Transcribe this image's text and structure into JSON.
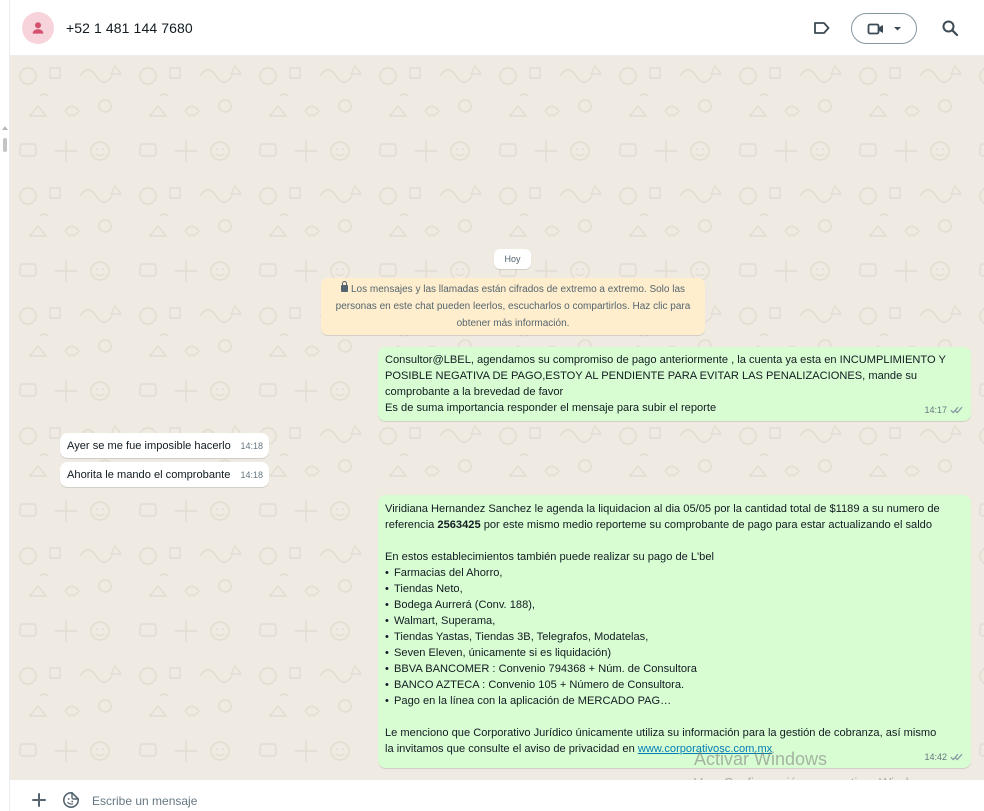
{
  "header": {
    "contact_name": "+52 1 481 144 7680",
    "icons": [
      "person-icon",
      "label-icon",
      "video-camera-icon",
      "chevron-down-icon",
      "search-icon"
    ],
    "accent_avatar_bg": "#f7d4dc"
  },
  "chat": {
    "wallpaper_color": "#efeae2",
    "day_label": "Hoy",
    "encryption_notice": {
      "line1": "Los mensajes y las llamadas están cifrados de extremo a extremo. Solo las",
      "line2": "personas en este chat pueden leerlos, escucharlos o compartirlos. Haz clic para",
      "line3": "obtener más información."
    },
    "messages": [
      {
        "direction": "outgoing",
        "lines": [
          "Consultor@LBEL, agendamos su compromiso de pago anteriormente , la cuenta ya esta en INCUMPLIMIENTO Y",
          "POSIBLE NEGATIVA DE PAGO,ESTOY AL PENDIENTE PARA EVITAR LAS PENALIZACIONES, mande su",
          "comprobante a la brevedad de favor",
          "Es de suma importancia responder el mensaje para subir el reporte"
        ],
        "time": "14:17",
        "status": "read"
      },
      {
        "direction": "incoming",
        "text": "Ayer se me fue imposible hacerlo",
        "time": "14:18"
      },
      {
        "direction": "incoming",
        "text": "Ahorita le mando el comprobante",
        "time": "14:18"
      },
      {
        "direction": "outgoing",
        "intro_line1": "Viridiana Hernandez Sanchez le agenda la liquidacion al dia 05/05  por la cantidad total de $1189 a su numero de",
        "intro_line2_prefix": "referencia ",
        "reference": "2563425",
        "intro_line2_suffix": "  por este mismo medio reporteme su comprobante de pago para estar actualizando el saldo",
        "establishments_title": "En estos establecimientos también puede realizar su pago de L'bel",
        "bullets": [
          "Farmacias del Ahorro,",
          "Tiendas Neto,",
          "Bodega Aurrerá (Conv. 188),",
          "Walmart, Superama,",
          "Tiendas Yastas, Tiendas 3B, Telegrafos, Modatelas,",
          "Seven Eleven, únicamente si es liquidación)",
          "BBVA BANCOMER : Convenio 794368 + Núm. de Consultora",
          "BANCO AZTECA : Convenio 105 + Número de Consultora.",
          "Pago en la línea con la aplicación de MERCADO PAG…"
        ],
        "bullet_char": "•",
        "closing_line1": "Le menciono que Corporativo Jurídico únicamente utiliza su información para la gestión de cobranza, así mismo",
        "closing_line2_prefix": "la invitamos que consulte el aviso de privacidad en ",
        "link_text": "www.corporativosc.com.mx",
        "time": "14:42",
        "status": "read"
      }
    ]
  },
  "footer": {
    "placeholder": "Escribe un mensaje",
    "icons": [
      "plus-icon",
      "sticker-icon"
    ]
  },
  "watermark": {
    "title": "Activar Windows",
    "subtitle": "Ve a Configuración para activar Windows."
  }
}
